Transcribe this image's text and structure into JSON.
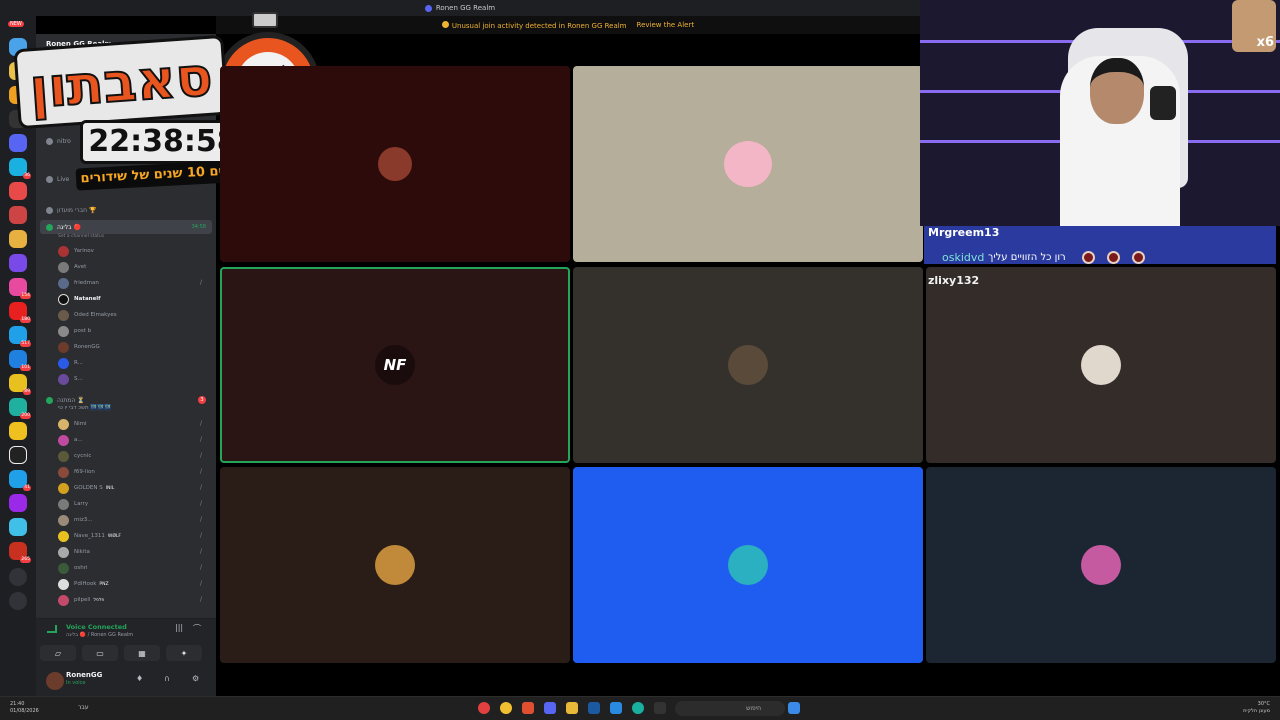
{
  "window": {
    "title": "Ronen GG Realm"
  },
  "alert": {
    "message": "Unusual join activity detected in Ronen GG Realm",
    "action": "Review the Alert"
  },
  "rail": {
    "new_label": "NEW",
    "badges": [
      "36",
      "154",
      "180",
      "517",
      "101",
      "89",
      "200",
      "41",
      "265"
    ]
  },
  "sidebar": {
    "server_name": "Ronen GG Realm",
    "channels": [
      {
        "label": "nitro",
        "time": "",
        "count": ""
      },
      {
        "label": "Live",
        "time": "",
        "count": ""
      },
      {
        "label": "חברי מועדון 🏆",
        "time": "",
        "count": ""
      },
      {
        "label": "בליגה 🔴",
        "time": "34:58",
        "count": ""
      },
      {
        "label": "המתנה ⏳",
        "time": "",
        "count": "3"
      }
    ],
    "channel_status": "Set a channel status",
    "users_a": [
      "Yarinov",
      "Avet",
      "friedman",
      "Natanelf",
      "Oded Elmakyes",
      "post b",
      "RonenGG",
      "R...",
      "S..."
    ],
    "users_b": [
      {
        "name": "תשכ דבי יו טי 🌃🌃🌃",
        "tag": ""
      },
      {
        "name": "Nimi",
        "tag": ""
      },
      {
        "name": "a...",
        "tag": ""
      },
      {
        "name": "cycnic",
        "tag": ""
      },
      {
        "name": "f69-lion",
        "tag": ""
      },
      {
        "name": "GOLDEN S",
        "tag": "INIL"
      },
      {
        "name": "Larry",
        "tag": ""
      },
      {
        "name": "miz3...",
        "tag": ""
      },
      {
        "name": "Nave_1311",
        "tag": "WØLF"
      },
      {
        "name": "Nikita",
        "tag": ""
      },
      {
        "name": "oshri",
        "tag": ""
      },
      {
        "name": "PdiHook",
        "tag": "PNZ"
      },
      {
        "name": "pilpeli",
        "tag": "פלפל"
      }
    ]
  },
  "voice": {
    "title": "Voice Connected",
    "subtitle": "בליגה 🔴 / Ronen GG Realm"
  },
  "user_panel": {
    "name": "RonenGG",
    "status": "In voice"
  },
  "overlay": {
    "title": "סאבתון",
    "timer": "22:38:58",
    "subtitle": "חוגגים 10 שנים של שידורים"
  },
  "tiles": [
    {
      "name": "tile-1",
      "bg": "#2e0b0b",
      "avatar": "#8a3a2a"
    },
    {
      "name": "tile-2",
      "bg": "#b5ae9a",
      "avatar": "#f2b6c6"
    },
    {
      "name": "tile-3",
      "bg": "#2a1414",
      "avatar": ""
    },
    {
      "name": "tile-4",
      "bg": "#34302c",
      "avatar": "#5a4a3a"
    },
    {
      "name": "tile-5",
      "bg": "#332c28",
      "avatar": "#e0d8cc"
    },
    {
      "name": "tile-6",
      "bg": "#2a1c16",
      "avatar": "#c08a3a"
    },
    {
      "name": "tile-7",
      "bg": "#1f5cf0",
      "avatar": "#2ab0c0"
    },
    {
      "name": "tile-8",
      "bg": "#1c2532",
      "avatar": "#c65aa0"
    }
  ],
  "nf_logo": "NF",
  "chat": {
    "user1": "Mrgreem13",
    "user2": "oskidvd",
    "message2": "רון כל הזוויים עליך",
    "user3": "zlixy132"
  },
  "webcam": {
    "badge": "x6"
  },
  "taskbar": {
    "time": "21:40",
    "date": "01/08/2026",
    "search_placeholder": "חיפוש",
    "weather": "30°C",
    "weather_desc": "מעונן חלקית",
    "left_lang": "עבר"
  }
}
